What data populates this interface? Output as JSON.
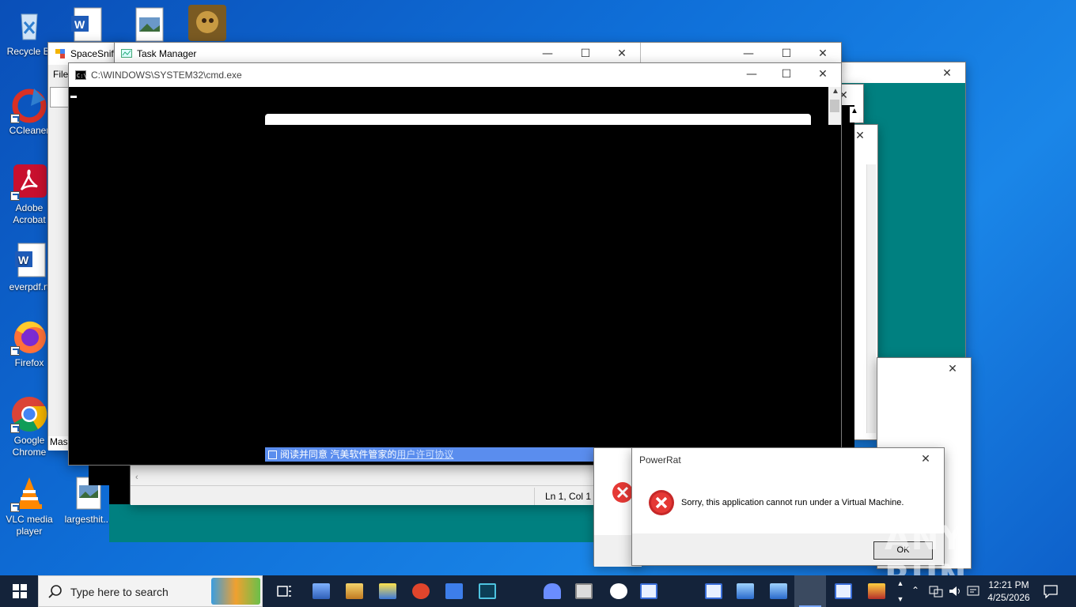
{
  "desktop": {
    "icons": [
      {
        "label": "Recycle Bi"
      },
      {
        "label": "CCleaner"
      },
      {
        "label": "Adobe Acrobat"
      },
      {
        "label": "everpdf.rt"
      },
      {
        "label": "Firefox"
      },
      {
        "label": "Google Chrome"
      },
      {
        "label": "VLC media player"
      },
      {
        "label": "largesthit..."
      }
    ]
  },
  "windows": {
    "spacesniffer": {
      "title": "SpaceSniff",
      "menu_file": "File",
      "status_fragment": "Mas"
    },
    "task_manager": {
      "title": "Task Manager"
    },
    "cmd": {
      "title": "C:\\WINDOWS\\SYSTEM32\\cmd.exe"
    },
    "notepad": {
      "status_position": "Ln 1, Col 1"
    },
    "installer_banner": {
      "text": "阅读并同意 汽美软件管家的",
      "link": "用户许可协议"
    },
    "powerrat": {
      "title": "PowerRat",
      "message": "Sorry, this application cannot run under a Virtual Machine.",
      "ok": "OK"
    }
  },
  "taskbar": {
    "search_placeholder": "Type here to search",
    "time": "12:21 PM",
    "date": "4/25/2026"
  },
  "watermark": {
    "text": "ANY RUN"
  },
  "colors": {
    "desktop": "#0f6fd8",
    "taskbar": "#14233a",
    "teal": "#008080",
    "error_red": "#d32f2f"
  }
}
